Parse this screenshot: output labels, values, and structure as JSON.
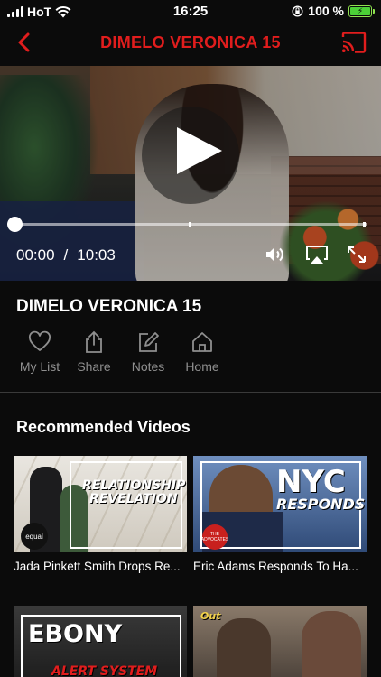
{
  "status_bar": {
    "carrier": "HoT",
    "time": "16:25",
    "battery": "100 %"
  },
  "header": {
    "title": "DIMELO VERONICA  15",
    "accent": "#e11d1d"
  },
  "player": {
    "current_time": "00:00",
    "separator": "/",
    "duration": "10:03",
    "progress": 0.0
  },
  "video": {
    "title": "DIMELO VERONICA  15"
  },
  "actions": [
    {
      "label": "My List",
      "icon": "heart-icon"
    },
    {
      "label": "Share",
      "icon": "share-icon"
    },
    {
      "label": "Notes",
      "icon": "edit-icon"
    },
    {
      "label": "Home",
      "icon": "home-icon"
    }
  ],
  "recommended": {
    "title": "Recommended Videos",
    "items": [
      {
        "title": "Jada Pinkett Smith Drops Re...",
        "overlay_line1": "RELATIONSHIP",
        "overlay_line2": "REVELATION",
        "badge": "equal"
      },
      {
        "title": "Eric Adams Responds To Ha...",
        "overlay_line1": "NYC",
        "overlay_line2": "RESPONDS",
        "badge": "THE ADVOCATES"
      },
      {
        "title": "",
        "overlay_line1": "EBONY",
        "overlay_line2": "ALERT SYSTEM"
      },
      {
        "title": "",
        "overlay_line1": "Out"
      }
    ]
  }
}
